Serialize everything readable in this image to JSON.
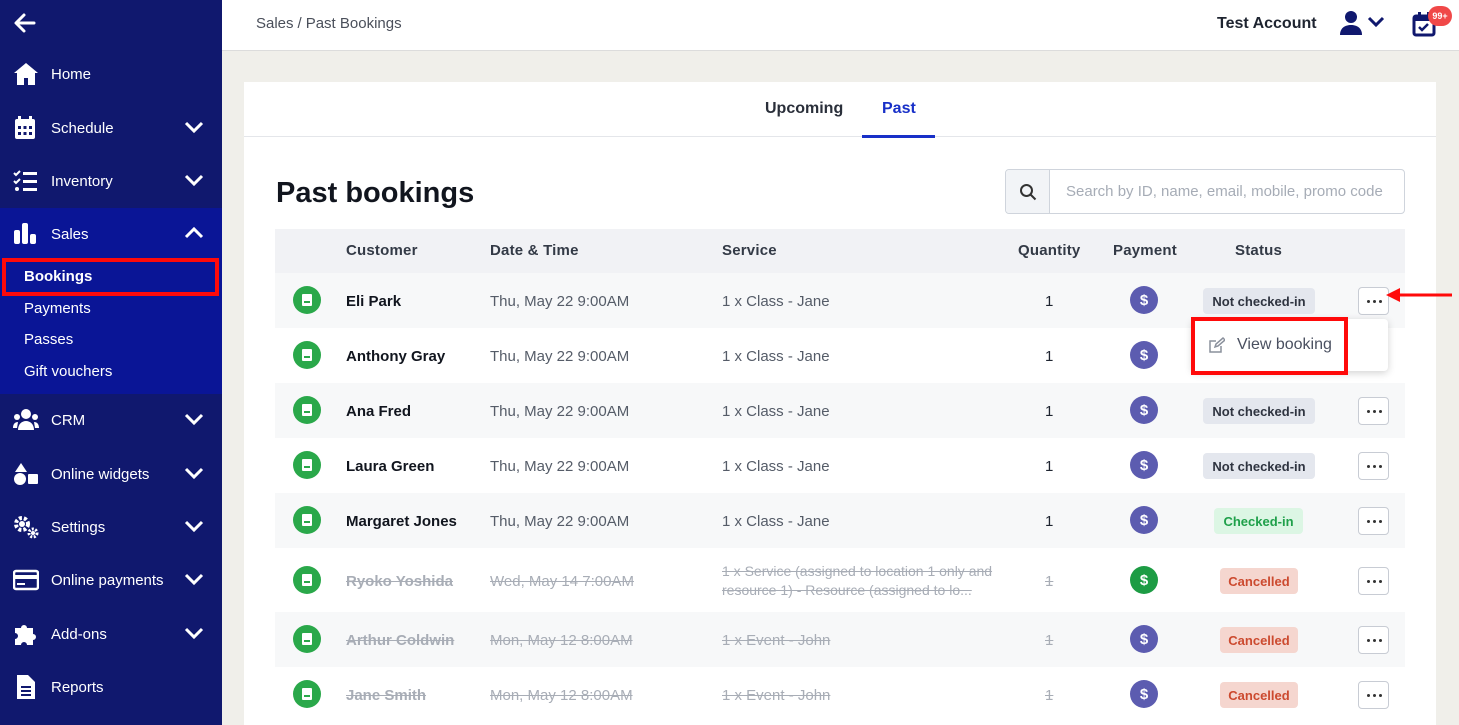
{
  "sidebar": {
    "items": [
      {
        "label": "Home",
        "icon": "home-icon"
      },
      {
        "label": "Schedule",
        "icon": "calendar-icon"
      },
      {
        "label": "Inventory",
        "icon": "checklist-icon"
      },
      {
        "label": "Sales",
        "icon": "bar-chart-icon"
      },
      {
        "label": "CRM",
        "icon": "users-icon"
      },
      {
        "label": "Online widgets",
        "icon": "shapes-icon"
      },
      {
        "label": "Settings",
        "icon": "gears-icon"
      },
      {
        "label": "Online payments",
        "icon": "credit-card-icon"
      },
      {
        "label": "Add-ons",
        "icon": "puzzle-icon"
      },
      {
        "label": "Reports",
        "icon": "document-icon"
      }
    ],
    "sales_sub": [
      "Bookings",
      "Payments",
      "Passes",
      "Gift vouchers"
    ],
    "active_sub": "Bookings"
  },
  "topbar": {
    "breadcrumb": [
      "Sales",
      "/",
      "Past Bookings"
    ],
    "account_name": "Test Account",
    "notification_count": "99+"
  },
  "tabs": [
    {
      "label": "Upcoming",
      "active": false
    },
    {
      "label": "Past",
      "active": true
    }
  ],
  "page_title": "Past bookings",
  "search": {
    "placeholder": "Search by ID, name, email, mobile, promo code",
    "value": ""
  },
  "table": {
    "headers": [
      "Customer",
      "Date & Time",
      "Service",
      "Quantity",
      "Payment",
      "Status"
    ],
    "rows": [
      {
        "customer": "Eli Park",
        "datetime": "Thu, May 22 9:00AM",
        "service": "1 x Class - Jane",
        "quantity": "1",
        "payment": "$",
        "status": "Not checked-in"
      },
      {
        "customer": "Anthony Gray",
        "datetime": "Thu, May 22 9:00AM",
        "service": "1 x Class - Jane",
        "quantity": "1",
        "payment": "$",
        "status": ""
      },
      {
        "customer": "Ana Fred",
        "datetime": "Thu, May 22 9:00AM",
        "service": "1 x Class - Jane",
        "quantity": "1",
        "payment": "$",
        "status": "Not checked-in"
      },
      {
        "customer": "Laura Green",
        "datetime": "Thu, May 22 9:00AM",
        "service": "1 x Class - Jane",
        "quantity": "1",
        "payment": "$",
        "status": "Not checked-in"
      },
      {
        "customer": "Margaret Jones",
        "datetime": "Thu, May 22 9:00AM",
        "service": "1 x Class - Jane",
        "quantity": "1",
        "payment": "$",
        "status": "Checked-in"
      },
      {
        "customer": "Ryoko Yoshida",
        "datetime": "Wed, May 14 7:00AM",
        "service": "1 x Service (assigned to location 1 only and resource 1) - Resource (assigned to lo...",
        "quantity": "1",
        "payment": "$",
        "status": "Cancelled"
      },
      {
        "customer": "Arthur Coldwin",
        "datetime": "Mon, May 12 8:00AM",
        "service": "1 x Event - John",
        "quantity": "1",
        "payment": "$",
        "status": "Cancelled"
      },
      {
        "customer": "Jane Smith",
        "datetime": "Mon, May 12 8:00AM",
        "service": "1 x Event - John",
        "quantity": "1",
        "payment": "$",
        "status": "Cancelled"
      }
    ]
  },
  "dropdown": {
    "items": [
      {
        "label": "View booking",
        "icon": "edit-icon"
      }
    ]
  },
  "colors": {
    "sidebar": "#10186e",
    "accent": "#1830c8",
    "highlight": "#ff0a0a"
  }
}
